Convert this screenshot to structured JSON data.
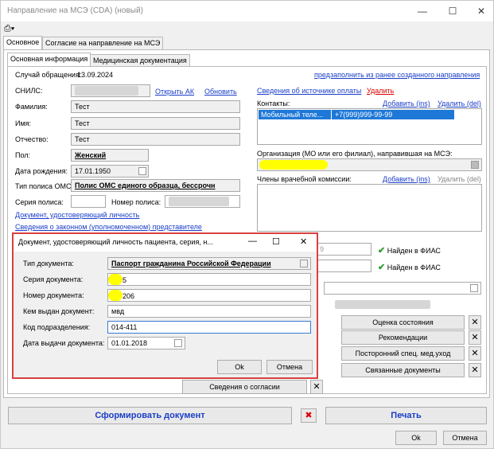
{
  "window": {
    "title": "Направление на МСЭ (CDA) (новый)",
    "min_icon": "—",
    "max_icon": "☐",
    "close_icon": "✕"
  },
  "toolbar": {
    "print_icon": "⎙▾"
  },
  "tabs": {
    "main": [
      "Основное",
      "Согласие на направление на МСЭ"
    ],
    "sub": [
      "Основная информация",
      "Медицинская документация"
    ]
  },
  "case": {
    "label": "Случай обращения:",
    "date": "13.09.2024",
    "prefill_link": "предзаполнить из ранее созданного направления"
  },
  "patient": {
    "snils_label": "СНИЛС:",
    "open_ak": "Открыть АК",
    "refresh": "Обновить",
    "surname_label": "Фамилия:",
    "surname": "Тест",
    "name_label": "Имя:",
    "name": "Тест",
    "patronymic_label": "Отчество:",
    "patronymic": "Тест",
    "sex_label": "Пол:",
    "sex": "Женский",
    "dob_label": "Дата рождения:",
    "dob": "17.01.1950",
    "policy_type_label": "Тип полиса ОМС:",
    "policy_type": "Полис ОМС единого образца, бессрочн",
    "policy_series_label": "Серия полиса:",
    "policy_number_label": "Номер полиса:",
    "identity_doc_link": "Документ, удостоверяющий личность",
    "representative_link": "Сведения о законном (уполномоченном) представителе"
  },
  "right": {
    "payment_link": "Сведения об источнике оплаты",
    "delete_link": "Удалить",
    "contacts_label": "Контакты:",
    "add_ins": "Добавить (ins)",
    "delete_del": "Удалить (del)",
    "contacts": [
      {
        "type": "Мобильный теле...",
        "value": "+7(999)999-99-99"
      }
    ],
    "org_label": "Организация (МО или его филиал), направившая на МСЭ:",
    "commission_label": "Члены врачебной комиссии:",
    "add_ins2": "Добавить (ins)",
    "delete_del2": "Удалить (del)",
    "fias1": "Найден в ФИАС",
    "fias2": "Найден в ФИАС",
    "address_partial": "9"
  },
  "side_buttons": [
    "Оценка состояния",
    "Рекомендации",
    "Посторонний спец. мед.уход",
    "Связанные документы"
  ],
  "consent_button": "Сведения о согласии",
  "footer": {
    "form_doc": "Сформировать документ",
    "print": "Печать",
    "ok": "Ok",
    "cancel": "Отмена"
  },
  "dialog": {
    "title": "Документ, удостоверяющий личность пациента, серия, н...",
    "doc_type_label": "Тип документа:",
    "doc_type": "Паспорт гражданина Российской Федерации",
    "series_label": "Серия документа:",
    "series": "5",
    "number_label": "Номер документа:",
    "number": "206",
    "issuer_label": "Кем выдан документ:",
    "issuer": "мвд",
    "code_label": "Код подразделения:",
    "code": "014-411",
    "issue_date_label": "Дата выдачи документа:",
    "issue_date": "01.01.2018",
    "ok": "Ok",
    "cancel": "Отмена"
  }
}
